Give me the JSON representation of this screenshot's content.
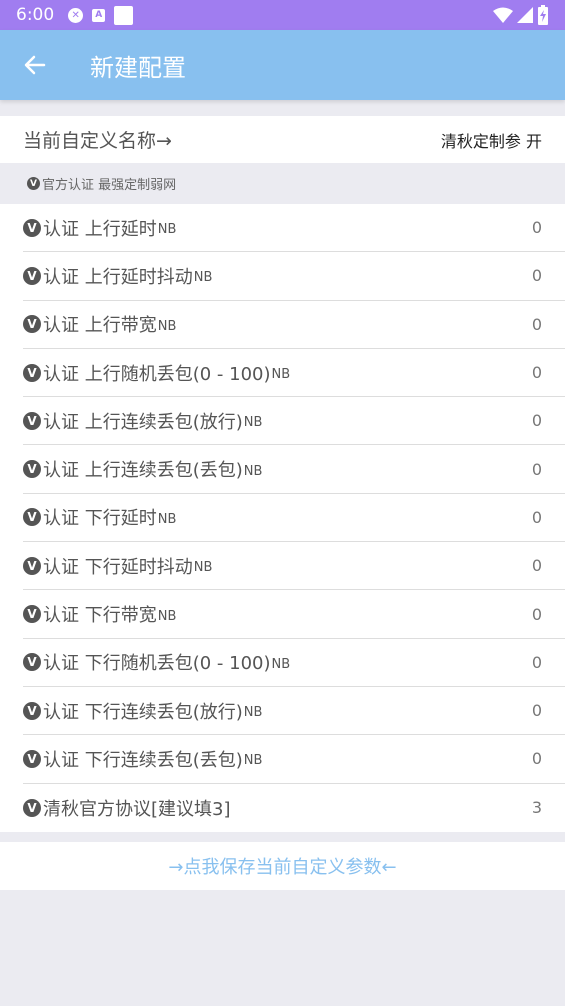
{
  "status_bar": {
    "time": "6:00",
    "icons": [
      "shield-notification-icon",
      "a-notification-icon",
      "blank-notification-icon",
      "wifi-icon",
      "signal-icon",
      "battery-icon"
    ]
  },
  "app_bar": {
    "title": "新建配置",
    "back_icon": "arrow-left-icon",
    "background": "#88c0ef"
  },
  "config_name": {
    "label": "当前自定义名称→",
    "value": "清秋定制参 开"
  },
  "section": {
    "badge": "V",
    "title": "官方认证 最强定制弱网"
  },
  "params": [
    {
      "badge": "V",
      "label": "认证 上行延时",
      "unit": "NB",
      "value": "0"
    },
    {
      "badge": "V",
      "label": "认证 上行延时抖动",
      "unit": "NB",
      "value": "0"
    },
    {
      "badge": "V",
      "label": "认证 上行带宽",
      "unit": "NB",
      "value": "0"
    },
    {
      "badge": "V",
      "label": "认证 上行随机丢包(0 - 100)",
      "unit": "NB",
      "value": "0"
    },
    {
      "badge": "V",
      "label": "认证 上行连续丢包(放行)",
      "unit": "NB",
      "value": "0"
    },
    {
      "badge": "V",
      "label": "认证 上行连续丢包(丢包)",
      "unit": "NB",
      "value": "0"
    },
    {
      "badge": "V",
      "label": "认证 下行延时",
      "unit": "NB",
      "value": "0"
    },
    {
      "badge": "V",
      "label": "认证 下行延时抖动",
      "unit": "NB",
      "value": "0"
    },
    {
      "badge": "V",
      "label": "认证 下行带宽",
      "unit": "NB",
      "value": "0"
    },
    {
      "badge": "V",
      "label": "认证 下行随机丢包(0 - 100)",
      "unit": "NB",
      "value": "0"
    },
    {
      "badge": "V",
      "label": "认证 下行连续丢包(放行)",
      "unit": "NB",
      "value": "0"
    },
    {
      "badge": "V",
      "label": "认证 下行连续丢包(丢包)",
      "unit": "NB",
      "value": "0"
    },
    {
      "badge": "V",
      "label": "清秋官方协议[建议填3]",
      "unit": "",
      "value": "3"
    }
  ],
  "save_button": {
    "label": "→点我保存当前自定义参数←"
  },
  "colors": {
    "status_bar": "#a07df0",
    "app_bar": "#88c0ef",
    "accent_text": "#88c0ef",
    "background": "#ebebf1"
  }
}
